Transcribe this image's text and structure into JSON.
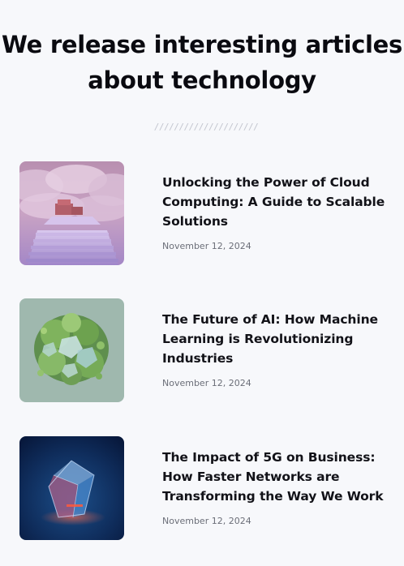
{
  "header": {
    "title_line1": "We release interesting articles",
    "title_line2": "about technology",
    "divider": "/////////////////////"
  },
  "articles": [
    {
      "title": "Unlocking the Power of Cloud Computing: A Guide to Scalable Solutions",
      "date": "November 12, 2024",
      "image_icon": "cloud-staircase-image"
    },
    {
      "title": "The Future of AI: How Machine Learning is Revolutionizing Industries",
      "date": "November 12, 2024",
      "image_icon": "green-crystal-cluster-image"
    },
    {
      "title": "The Impact of 5G on Business: How Faster Networks are Transforming the Way We Work",
      "date": "November 12, 2024",
      "image_icon": "glowing-glass-cube-image"
    }
  ],
  "colors": {
    "background": "#f7f8fb",
    "text": "#121218",
    "muted": "#6b6e78"
  }
}
